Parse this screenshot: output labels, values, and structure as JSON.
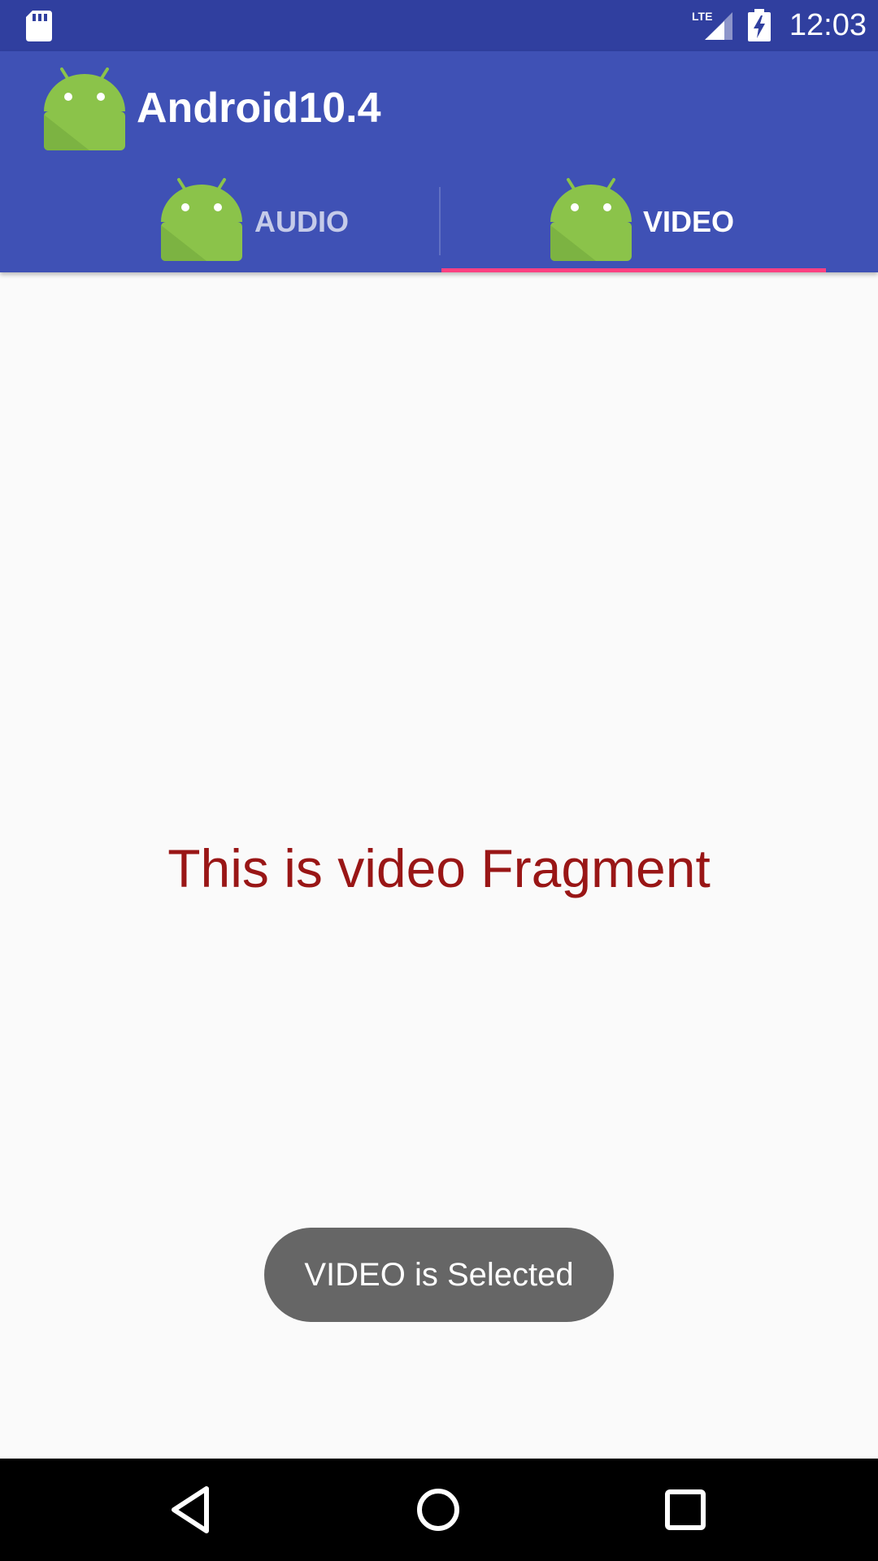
{
  "status_bar": {
    "time": "12:03",
    "network": "LTE",
    "icons": [
      "sd-card-icon",
      "lte-signal-icon",
      "battery-charging-icon"
    ]
  },
  "toolbar": {
    "title": "Android10.4",
    "logo_icon": "android-icon"
  },
  "tabs": [
    {
      "label": "AUDIO",
      "icon": "android-icon",
      "selected": false
    },
    {
      "label": "VIDEO",
      "icon": "android-icon",
      "selected": true
    }
  ],
  "content": {
    "text": "This is video Fragment"
  },
  "toast": {
    "text": "VIDEO is Selected"
  },
  "nav_bar": {
    "icons": [
      "back-icon",
      "home-icon",
      "recent-apps-icon"
    ]
  },
  "colors": {
    "status_bar": "#303f9f",
    "primary": "#3f51b5",
    "accent": "#ff4081",
    "android_green": "#a4c639",
    "fragment_text": "#991616",
    "toast_bg": "#666666"
  }
}
